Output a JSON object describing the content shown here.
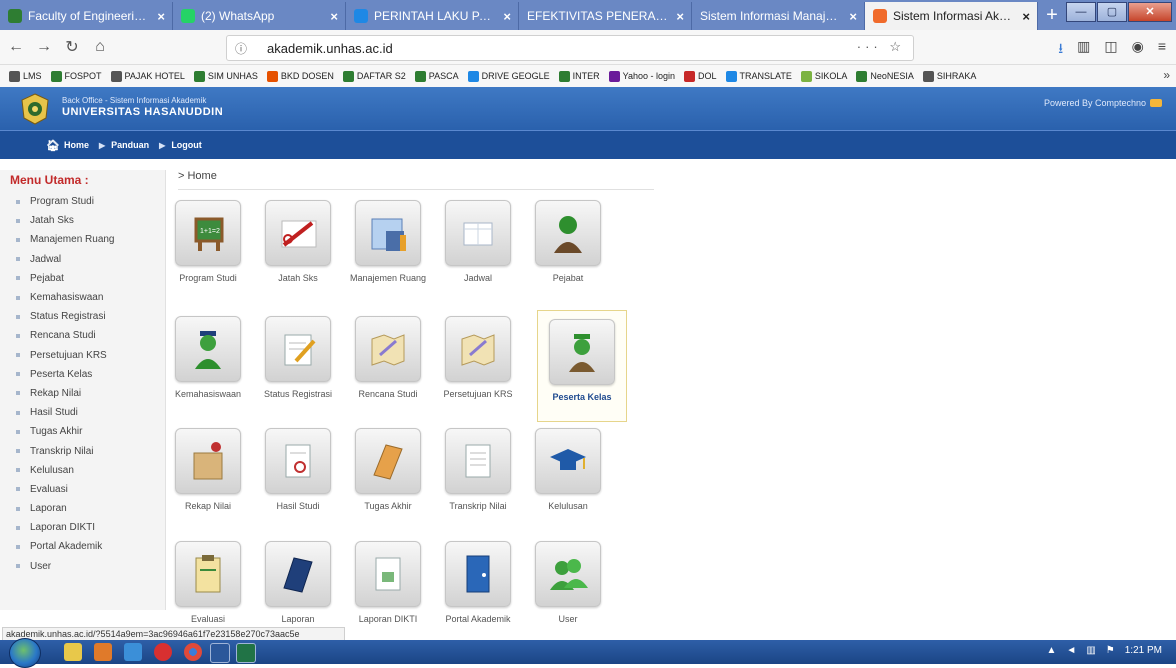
{
  "browser": {
    "tabs": [
      {
        "title": "Faculty of Engineering | H",
        "icon_color": "#2e7d32",
        "active": false
      },
      {
        "title": "(2) WhatsApp",
        "icon_color": "#25d366",
        "active": false
      },
      {
        "title": "PERINTAH LAKU PADA PEX",
        "icon_color": "#1e88e5",
        "active": false
      },
      {
        "title": "EFEKTIVITAS PENERAPAN SIST",
        "icon_color": "#cccccc",
        "active": false
      },
      {
        "title": "Sistem Informasi Manajemen",
        "icon_color": "#cccccc",
        "active": false
      },
      {
        "title": "Sistem Informasi Akademi",
        "icon_color": "#f06a2a",
        "active": true
      }
    ],
    "new_tab": "+",
    "url": "akademik.unhas.ac.id",
    "url_actions": "··· ☆",
    "bookmarks": [
      {
        "label": "LMS",
        "color": "#555555"
      },
      {
        "label": "FOSPOT",
        "color": "#2e7d32"
      },
      {
        "label": "PAJAK HOTEL",
        "color": "#555555"
      },
      {
        "label": "SIM UNHAS",
        "color": "#2e7d32"
      },
      {
        "label": "BKD DOSEN",
        "color": "#e65100"
      },
      {
        "label": "DAFTAR S2",
        "color": "#2e7d32"
      },
      {
        "label": "PASCA",
        "color": "#2e7d32"
      },
      {
        "label": "DRIVE GEOGLE",
        "color": "#1e88e5"
      },
      {
        "label": "INTER",
        "color": "#2e7d32"
      },
      {
        "label": "Yahoo - login",
        "color": "#6a1b9a"
      },
      {
        "label": "DOL",
        "color": "#c62828"
      },
      {
        "label": "TRANSLATE",
        "color": "#1e88e5"
      },
      {
        "label": "SIKOLA",
        "color": "#7cb342"
      },
      {
        "label": "NeoNESIA",
        "color": "#2e7d32"
      },
      {
        "label": "SIHRAKA",
        "color": "#555555"
      }
    ]
  },
  "site": {
    "subtitle": "Back Office - Sistem Informasi Akademik",
    "name": "UNIVERSITAS HASANUDDIN",
    "powered": "Powered By Comptechno",
    "menu": [
      "Home",
      "Panduan",
      "Logout"
    ]
  },
  "sidebar": {
    "title": "Menu Utama :",
    "items": [
      "Program Studi",
      "Jatah Sks",
      "Manajemen Ruang",
      "Jadwal",
      "Pejabat",
      "Kemahasiswaan",
      "Status Registrasi",
      "Rencana Studi",
      "Persetujuan KRS",
      "Peserta Kelas",
      "Rekap Nilai",
      "Hasil Studi",
      "Tugas Akhir",
      "Transkrip Nilai",
      "Kelulusan",
      "Evaluasi",
      "Laporan",
      "Laporan DIKTI",
      "Portal Akademik",
      "User"
    ]
  },
  "main": {
    "breadcrumb": "> Home",
    "tiles": [
      {
        "label": "Program Studi",
        "icon": "blackboard-icon"
      },
      {
        "label": "Jatah Sks",
        "icon": "scissors-icon"
      },
      {
        "label": "Manajemen Ruang",
        "icon": "building-icon"
      },
      {
        "label": "Jadwal",
        "icon": "calendar-icon"
      },
      {
        "label": "Pejabat",
        "icon": "official-icon"
      },
      {
        "label": "Kemahasiswaan",
        "icon": "student-icon"
      },
      {
        "label": "Status Registrasi",
        "icon": "edit-icon"
      },
      {
        "label": "Rencana Studi",
        "icon": "map-icon"
      },
      {
        "label": "Persetujuan KRS",
        "icon": "map-check-icon"
      },
      {
        "label": "Peserta Kelas",
        "icon": "class-member-icon"
      },
      {
        "label": "Rekap Nilai",
        "icon": "box-icon"
      },
      {
        "label": "Hasil Studi",
        "icon": "document-stamp-icon"
      },
      {
        "label": "Tugas Akhir",
        "icon": "notebook-icon"
      },
      {
        "label": "Transkrip Nilai",
        "icon": "transcript-icon"
      },
      {
        "label": "Kelulusan",
        "icon": "graduation-cap-icon"
      },
      {
        "label": "Evaluasi",
        "icon": "clipboard-icon"
      },
      {
        "label": "Laporan",
        "icon": "report-book-icon"
      },
      {
        "label": "Laporan DIKTI",
        "icon": "report-doc-icon"
      },
      {
        "label": "Portal Akademik",
        "icon": "door-icon"
      },
      {
        "label": "User",
        "icon": "users-icon"
      }
    ]
  },
  "status_url": "akademik.unhas.ac.id/?5514a9em=3ac96946a61f7e23158e270c73aac5e",
  "taskbar": {
    "time": "1:21 PM"
  }
}
